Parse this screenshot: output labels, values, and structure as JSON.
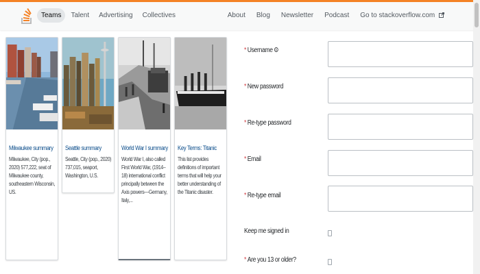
{
  "header": {
    "nav_left": [
      "Teams",
      "Talent",
      "Advertising",
      "Collectives"
    ],
    "nav_right": [
      "About",
      "Blog",
      "Newsletter",
      "Podcast",
      "Go to stackoverflow.com"
    ],
    "external_icon": "external-link-icon",
    "brand_color": "#f48225"
  },
  "cards": [
    {
      "title": "Milwaukee summary",
      "desc": "Milwaukee, City (pop., 2020) 577,222, seat of Milwaukee county, southeastern Wisconsin, US.",
      "image": "milwaukee-riverfront-photo"
    },
    {
      "title": "Seattle summary",
      "desc": "Seattle, City (pop., 2020) 737,015, seaport, Washington, U.S.",
      "image": "seattle-skyline-photo"
    },
    {
      "title": "World War I summary",
      "desc": "World War I, also called First World War, (1914–18) international conflict principally between the Axis powers—Germany, Italy,...",
      "image": "world-war-i-photo"
    },
    {
      "title": "Key Terms: Titanic",
      "desc": "This list provides definitions of important terms that will help your better understanding of the Titanic disaster.",
      "image": "titanic-photo"
    }
  ],
  "form": {
    "username_label": "Username",
    "username_icon": "info-icon",
    "new_password_label": "New password",
    "retype_password_label": "Re-type password",
    "email_label": "Email",
    "retype_email_label": "Re-type email",
    "keep_signed_in_label": "Keep me signed in",
    "age_label": "Are you 13 or older?",
    "required_marker": "*"
  }
}
